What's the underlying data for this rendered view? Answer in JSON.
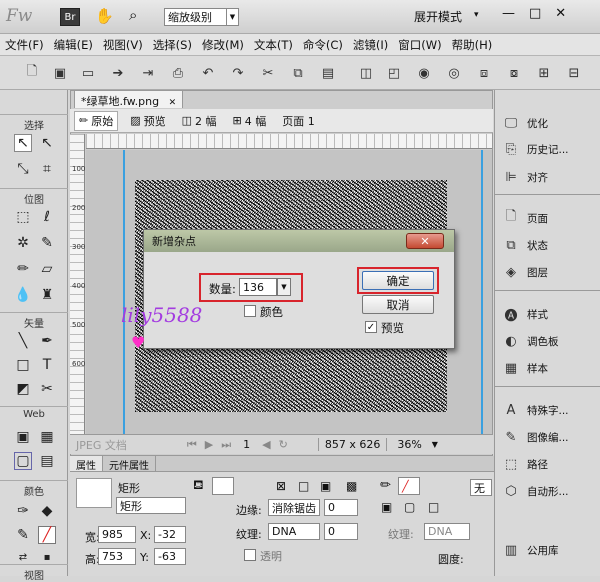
{
  "app": {
    "logo": "Fw",
    "br_badge": "Br",
    "zoom_label": "缩放级别",
    "mode": "展开模式",
    "mode_arrow": "▾",
    "win_min": "—",
    "win_max": "□",
    "win_close": "✕"
  },
  "menu": [
    "文件(F)",
    "编辑(E)",
    "视图(V)",
    "选择(S)",
    "修改(M)",
    "文本(T)",
    "命令(C)",
    "滤镜(I)",
    "窗口(W)",
    "帮助(H)"
  ],
  "document": {
    "tab": "*绿草地.fw.png",
    "tab_close": "✕",
    "views": {
      "original": "原始",
      "preview": "预览",
      "two_up": "2 幅",
      "four_up": "4 幅",
      "page": "页面 1"
    },
    "ruler_left": [
      "100",
      "200",
      "300",
      "400",
      "500",
      "600"
    ],
    "status": {
      "format": "JPEG 文档",
      "page_num": "1",
      "size": "857 x 626",
      "zoom": "36%"
    }
  },
  "left_tools": {
    "select": "选择",
    "bitmap": "位图",
    "vector": "矢量",
    "web": "Web",
    "colors": "颜色",
    "view": "视图"
  },
  "dialog": {
    "title": "新增杂点",
    "close": "✕",
    "amount_label": "数量:",
    "amount_value": "136",
    "color_label": "颜色",
    "ok": "确定",
    "cancel": "取消",
    "preview_label": "预览",
    "preview_check": "✓"
  },
  "right_panels": [
    "优化",
    "历史记...",
    "对齐",
    "页面",
    "状态",
    "图层",
    "样式",
    "调色板",
    "样本",
    "特殊字...",
    "图像编...",
    "路径",
    "自动形...",
    "公用库"
  ],
  "props": {
    "tabs": [
      "属性",
      "元件属性"
    ],
    "shape_type": "矩形",
    "shape_name": "矩形",
    "w_label": "宽:",
    "w_value": "985",
    "h_label": "高:",
    "h_value": "753",
    "x_label": "X:",
    "x_value": "-32",
    "y_label": "Y:",
    "y_value": "-63",
    "edge_label": "边缘:",
    "edge_value": "消除锯齿",
    "edge_num": "0",
    "texture_label": "纹理:",
    "texture_value": "DNA",
    "texture_num": "0",
    "transparent": "透明",
    "stroke_none": "无",
    "edge2_label": "边缘:",
    "texture2_label": "纹理:",
    "texture2_value": "DNA",
    "roundness_label": "圆度:"
  },
  "watermark": "lily5588",
  "colors": {
    "accent_red": "#d8242c",
    "guide_blue": "#3aa0e0",
    "dialog_title": "#a7b392"
  }
}
